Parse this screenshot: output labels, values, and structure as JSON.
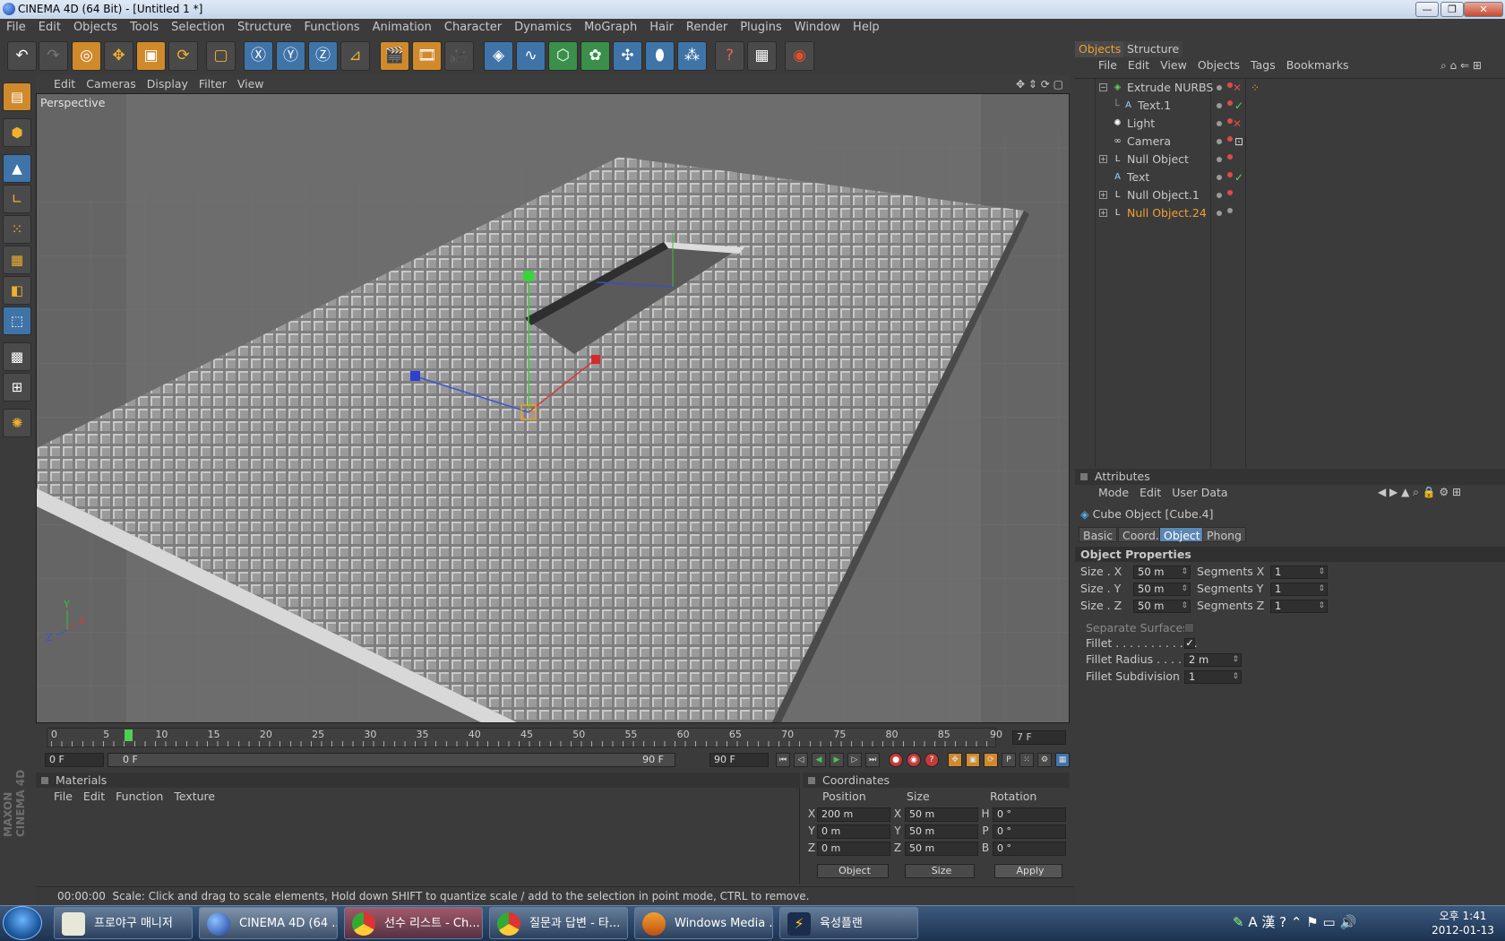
{
  "window": {
    "title": "CINEMA 4D (64 Bit) - [Untitled 1 *]",
    "min": "—",
    "max": "❐",
    "close": "✕"
  },
  "menubar": [
    "File",
    "Edit",
    "Objects",
    "Tools",
    "Selection",
    "Structure",
    "Functions",
    "Animation",
    "Character",
    "Dynamics",
    "MoGraph",
    "Hair",
    "Render",
    "Plugins",
    "Window",
    "Help"
  ],
  "viewport": {
    "menu": [
      "Edit",
      "Cameras",
      "Display",
      "Filter",
      "View"
    ],
    "label": "Perspective",
    "axis": {
      "x": "X",
      "y": "Y",
      "z": "Z"
    }
  },
  "timeline": {
    "ticks": [
      "0",
      "5",
      "10",
      "15",
      "20",
      "25",
      "30",
      "35",
      "40",
      "45",
      "50",
      "55",
      "60",
      "65",
      "70",
      "75",
      "80",
      "85",
      "90"
    ],
    "current_frame": "7 F",
    "playhead_frame": 7
  },
  "transport": {
    "start": "0 F",
    "range_start": "0 F",
    "range_end": "90 F",
    "end": "90 F"
  },
  "materials": {
    "title": "Materials",
    "menu": [
      "File",
      "Edit",
      "Function",
      "Texture"
    ]
  },
  "coordinates": {
    "title": "Coordinates",
    "headers": [
      "Position",
      "Size",
      "Rotation"
    ],
    "rows": [
      {
        "a": "X",
        "pos": "200 m",
        "s": "X",
        "size": "50 m",
        "r": "H",
        "rot": "0 °"
      },
      {
        "a": "Y",
        "pos": "0 m",
        "s": "Y",
        "size": "50 m",
        "r": "P",
        "rot": "0 °"
      },
      {
        "a": "Z",
        "pos": "0 m",
        "s": "Z",
        "size": "50 m",
        "r": "B",
        "rot": "0 °"
      }
    ],
    "mode_select": "Object",
    "size_select": "Size",
    "apply": "Apply"
  },
  "status": {
    "time": "00:00:00",
    "message": "Scale: Click and drag to scale elements, Hold down SHIFT to quantize scale / add to the selection in point mode, CTRL to remove."
  },
  "objects": {
    "tabs": [
      "Objects",
      "Structure"
    ],
    "menu": [
      "File",
      "Edit",
      "View",
      "Objects",
      "Tags",
      "Bookmarks"
    ],
    "items": [
      {
        "name": "Extrude NURBS",
        "icon": "extrude-nurbs-icon",
        "indent": 0,
        "expand": "−"
      },
      {
        "name": "Text.1",
        "icon": "text-spline-icon",
        "indent": 1,
        "expand": ""
      },
      {
        "name": "Light",
        "icon": "light-icon",
        "indent": 0,
        "expand": ""
      },
      {
        "name": "Camera",
        "icon": "camera-icon",
        "indent": 0,
        "expand": ""
      },
      {
        "name": "Null Object",
        "icon": "null-object-icon",
        "indent": 0,
        "expand": "+"
      },
      {
        "name": "Text",
        "icon": "text-spline-icon",
        "indent": 0,
        "expand": ""
      },
      {
        "name": "Null Object.1",
        "icon": "null-object-icon",
        "indent": 0,
        "expand": "+"
      },
      {
        "name": "Null Object.24",
        "icon": "null-object-icon",
        "indent": 0,
        "expand": "+",
        "selected": true
      }
    ]
  },
  "attributes": {
    "title": "Attributes",
    "menu": [
      "Mode",
      "Edit",
      "User Data"
    ],
    "object": "Cube Object [Cube.4]",
    "tabs": [
      "Basic",
      "Coord.",
      "Object",
      "Phong"
    ],
    "section": "Object Properties",
    "size_x_label": "Size . X",
    "size_x": "50 m",
    "seg_x_label": "Segments X",
    "seg_x": "1",
    "size_y_label": "Size . Y",
    "size_y": "50 m",
    "seg_y_label": "Segments Y",
    "seg_y": "1",
    "size_z_label": "Size . Z",
    "size_z": "50 m",
    "seg_z_label": "Segments Z",
    "seg_z": "1",
    "separate_label": "Separate Surfaces",
    "fillet_label": "Fillet . . . . . . . . . . . .",
    "fillet_check": "✓",
    "fillet_radius_label": "Fillet Radius . . . . . .",
    "fillet_radius": "2 m",
    "fillet_sub_label": "Fillet Subdivision",
    "fillet_sub": "1"
  },
  "taskbar": {
    "items": [
      "프로야구 매니저",
      "CINEMA 4D (64 ...",
      "선수 리스트 - Ch...",
      "질문과 답변 - 타...",
      "Windows Media ...",
      "육성플랜"
    ],
    "clock_time": "오후 1:41",
    "clock_date": "2012-01-13",
    "ime": "A 漢"
  },
  "maxon": "MAXON CINEMA 4D",
  "colors": {
    "accent": "#d08a2c",
    "selected_object": "#f0a030",
    "viewport_bg": "#656565"
  }
}
